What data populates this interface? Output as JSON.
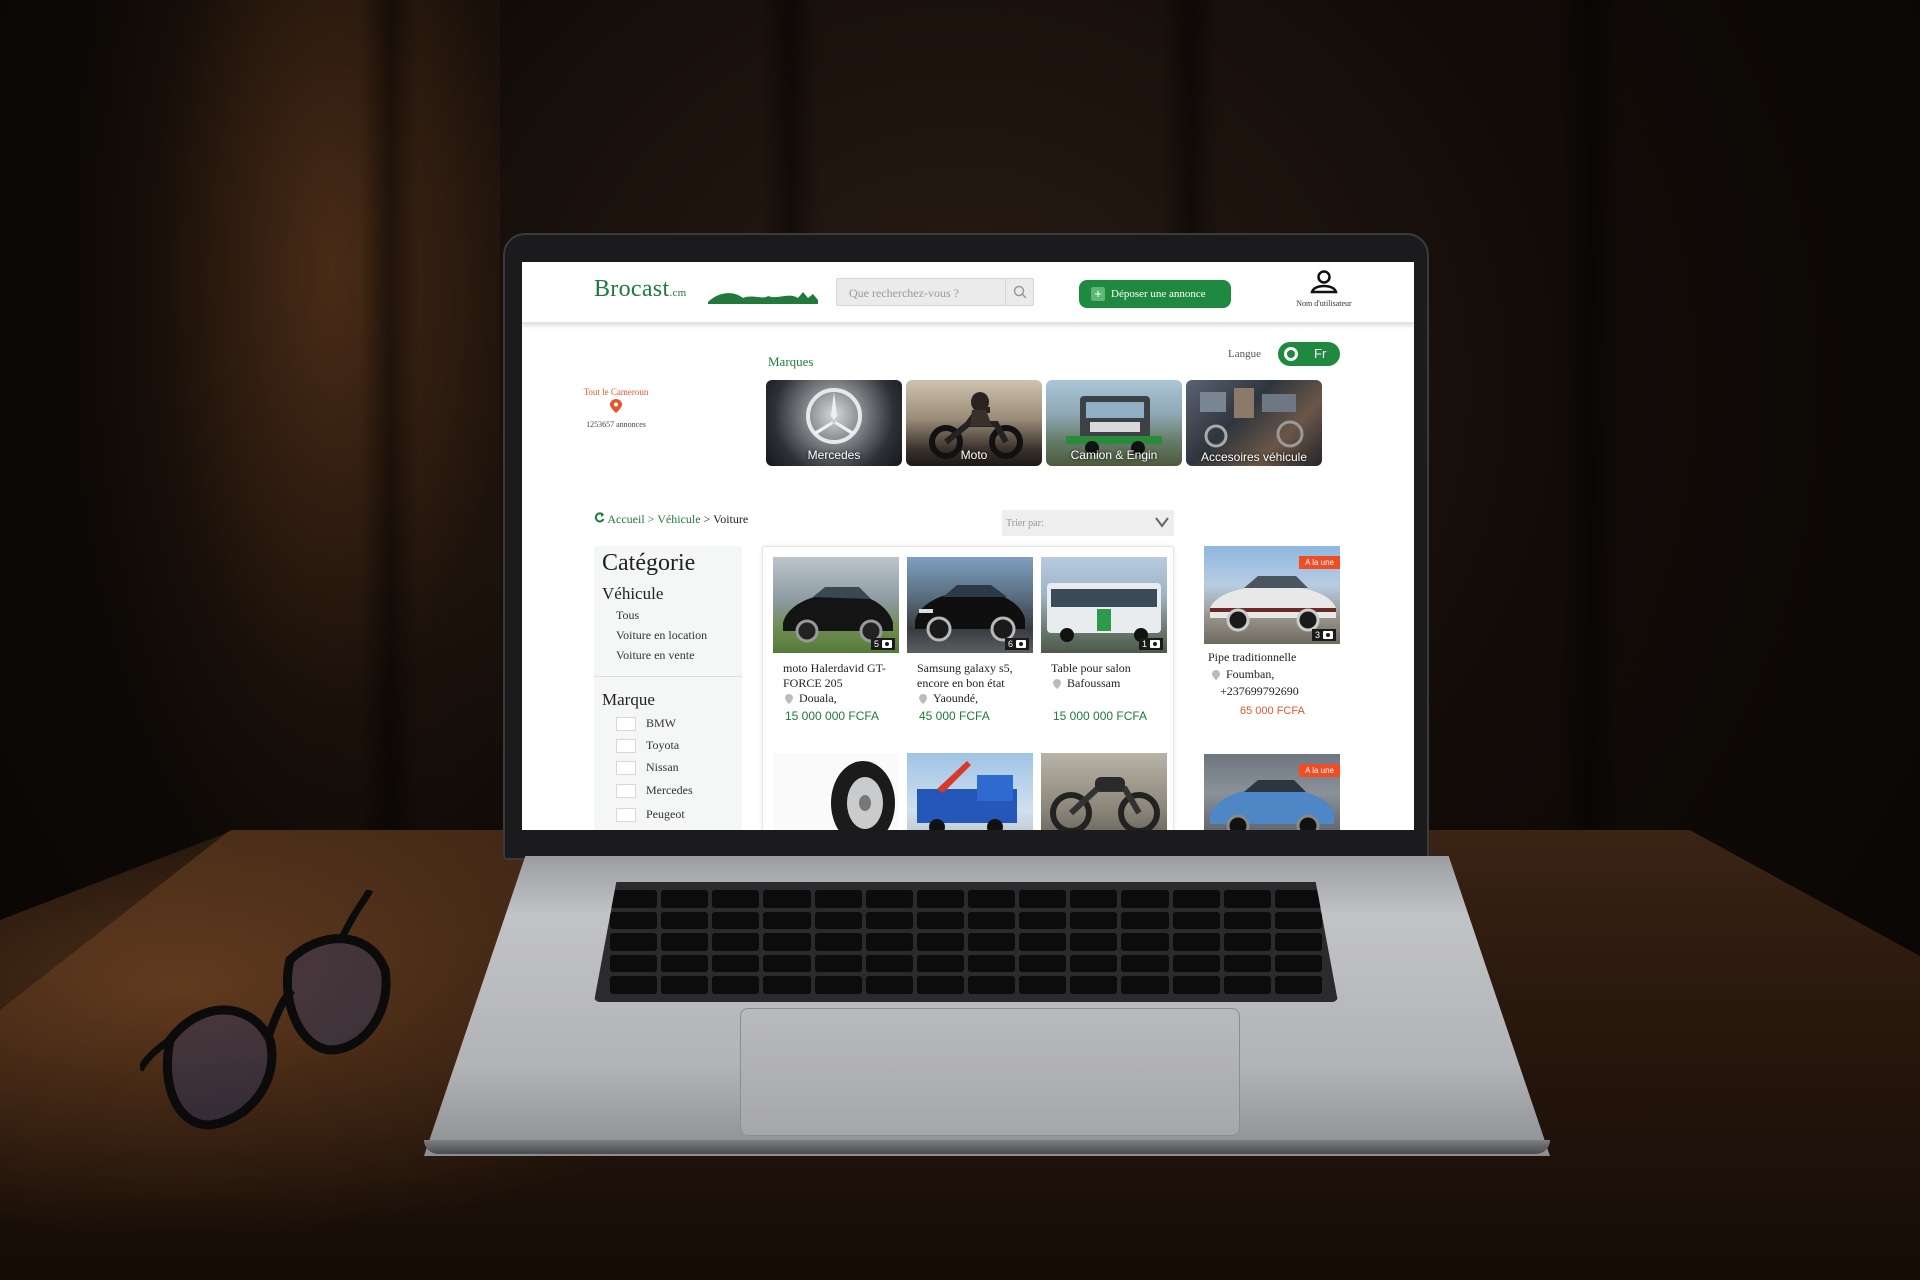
{
  "header": {
    "logo_main": "Brocast",
    "logo_suffix": ".cm",
    "search_placeholder": "Que recherchez-vous ?",
    "post_button": "Déposer une annonce",
    "user_label": "Nom d'utilisateur"
  },
  "language": {
    "label": "Langue",
    "value": "Fr"
  },
  "location": {
    "title": "Tout le Cameroun",
    "count": "1253657  annonces"
  },
  "brands": {
    "title": "Marques",
    "items": [
      {
        "label": "Mercedes"
      },
      {
        "label": "Moto"
      },
      {
        "label": "Camion & Engin"
      },
      {
        "label": "Accesoires véhicule"
      }
    ]
  },
  "breadcrumb": {
    "home": "Accueil",
    "sep1": " > ",
    "category": "Véhicule",
    "sep2": " > ",
    "current": "Voiture"
  },
  "sort": {
    "placeholder": "Trier par:"
  },
  "sidebar": {
    "title": "Catégorie",
    "section": "Véhicule",
    "sub_items": [
      "Tous",
      "Voiture en location",
      "Voiture en vente"
    ],
    "brand_title": "Marque",
    "brand_options": [
      "BMW",
      "Toyota",
      "Nissan",
      "Mercedes",
      "Peugeot"
    ]
  },
  "listings": [
    {
      "title": "moto Halerdavid GT-FORCE 205",
      "location": "Douala,",
      "price": "15 000 000 FCFA",
      "photos": "5"
    },
    {
      "title": "Samsung galaxy s5, encore en bon état",
      "location": "Yaoundé,",
      "price": "45 000 FCFA",
      "photos": "6"
    },
    {
      "title": "Table pour salon",
      "location": "Bafoussam",
      "price": "15 000 000 FCFA",
      "photos": "1"
    }
  ],
  "featured": [
    {
      "ribbon": "A la une",
      "title": "Pipe traditionnelle",
      "location": "Foumban,",
      "phone": "+237699792690",
      "price": "65 000 FCFA",
      "photos": "3"
    },
    {
      "ribbon": "A la une",
      "photos": "1"
    }
  ],
  "colors": {
    "brand_green": "#1f8a3f",
    "accent_orange": "#f04d25"
  }
}
